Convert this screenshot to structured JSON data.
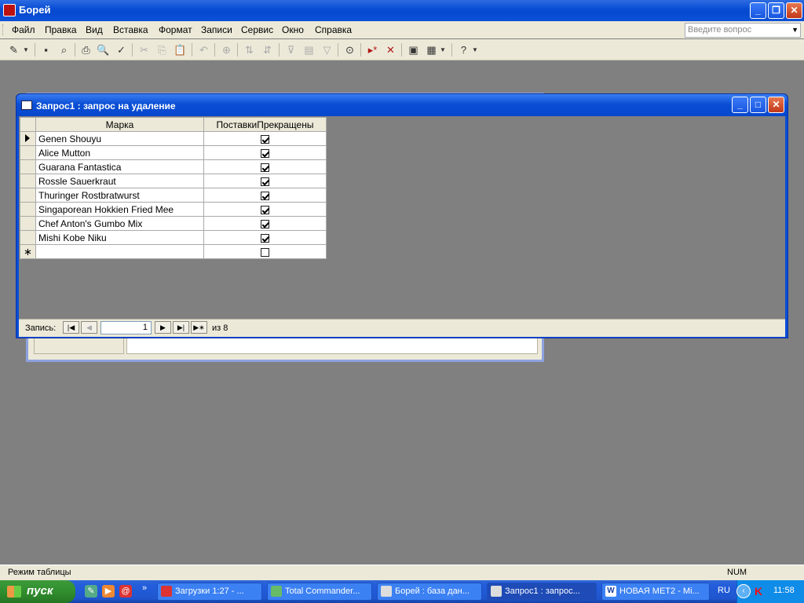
{
  "app": {
    "title": "Борей"
  },
  "menu": [
    "Файл",
    "Правка",
    "Вид",
    "Вставка",
    "Формат",
    "Записи",
    "Сервис",
    "Окно",
    "Справка"
  ],
  "ask_placeholder": "Введите вопрос",
  "query_window": {
    "title": "Запрос1 : запрос на удаление",
    "columns": [
      "Марка",
      "ПоставкиПрекращены"
    ],
    "rows": [
      {
        "name": "Genen Shouyu",
        "discontinued": true
      },
      {
        "name": "Alice Mutton",
        "discontinued": true
      },
      {
        "name": "Guarana Fantastica",
        "discontinued": true
      },
      {
        "name": "Rossle Sauerkraut",
        "discontinued": true
      },
      {
        "name": "Thuringer Rostbratwurst",
        "discontinued": true
      },
      {
        "name": "Singaporean Hokkien Fried Mee",
        "discontinued": true
      },
      {
        "name": "Chef Anton's Gumbo Mix",
        "discontinued": true
      },
      {
        "name": "Mishi Kobe Niku",
        "discontinued": true
      }
    ],
    "new_row_discontinued": false,
    "navigator": {
      "label": "Запись:",
      "current": "1",
      "of_text": "из 8"
    }
  },
  "status": {
    "mode": "Режим таблицы",
    "num": "NUM"
  },
  "taskbar": {
    "start": "пуск",
    "tasks": [
      "Загрузки 1:27 - ...",
      "Total Commander...",
      "Борей : база дан...",
      "Запрос1 : запрос...",
      "НОВАЯ МЕТ2 - Mi..."
    ],
    "lang": "RU",
    "time": "11:58"
  }
}
